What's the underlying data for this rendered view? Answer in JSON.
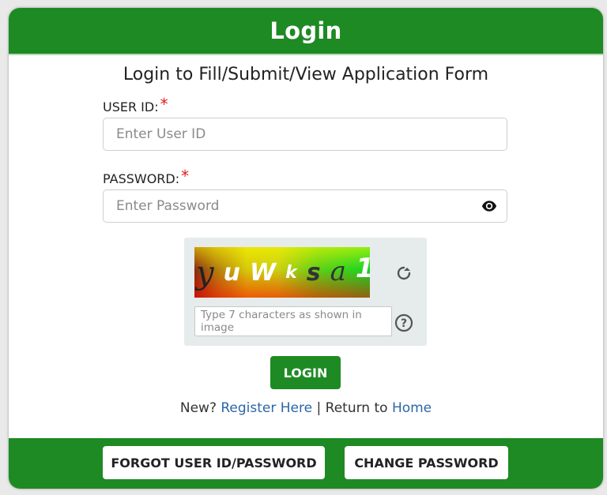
{
  "header": {
    "title": "Login"
  },
  "subtitle": "Login to Fill/Submit/View Application Form",
  "user_id": {
    "label": "USER ID:",
    "required_mark": "*",
    "placeholder": "Enter User ID"
  },
  "password": {
    "label": "PASSWORD:",
    "required_mark": "*",
    "placeholder": "Enter Password",
    "toggle_icon": "eye-icon"
  },
  "captcha": {
    "characters": [
      "y",
      "u",
      "W",
      "k",
      "s",
      "a",
      "1"
    ],
    "input_placeholder": "Type 7 characters as shown in image",
    "refresh_icon": "refresh-icon",
    "help_icon": "help-icon"
  },
  "login_button": "LOGIN",
  "links": {
    "new_prefix": "New?",
    "register": "Register Here",
    "separator": "|",
    "return_prefix": "Return to",
    "home": "Home"
  },
  "footer": {
    "forgot": "FORGOT USER ID/PASSWORD",
    "change": "CHANGE PASSWORD"
  },
  "colors": {
    "brand_green": "#1e8a23",
    "link_blue": "#2b67a6",
    "required_red": "#e02020"
  }
}
